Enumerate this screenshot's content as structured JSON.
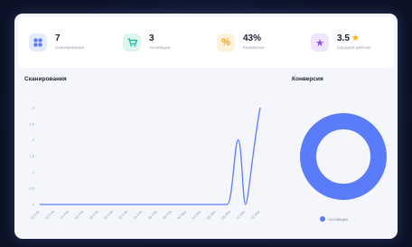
{
  "stats": [
    {
      "value": "7",
      "label": "Сканирования",
      "icon": "grid-icon",
      "icon_color": "#5b7cfa",
      "icon_bg": "#e6ecff"
    },
    {
      "value": "3",
      "label": "Активации",
      "icon": "cart-icon",
      "icon_color": "#16b89a",
      "icon_bg": "#ddf6f0"
    },
    {
      "value": "43%",
      "label": "Конверсия",
      "icon": "percent-icon",
      "icon_color": "#f3a21b",
      "icon_bg": "#fff1da"
    },
    {
      "value": "3.5",
      "label": "Средний рейтинг",
      "icon": "star-icon",
      "icon_color": "#8b4df0",
      "icon_bg": "#efe5ff"
    }
  ],
  "scans_panel": {
    "title": "Сканирования"
  },
  "conversion_panel": {
    "title": "Конверсия"
  },
  "colors": {
    "accent": "#5b7cfa",
    "background": "#0c1226",
    "card": "#f4f6fb"
  },
  "chart_data": [
    {
      "type": "line",
      "title": "Сканирования",
      "x": [
        "10 Feb",
        "12 Feb",
        "14 Feb",
        "16 Feb",
        "18 Feb",
        "20 Feb",
        "22 Feb",
        "24 Feb",
        "26 Feb",
        "28 Feb",
        "02 Mar",
        "04 Mar",
        "06 Mar",
        "08 Mar",
        "10 Mar",
        "12 Mar"
      ],
      "series": [
        {
          "values": [
            0,
            0,
            0,
            0,
            0,
            0,
            0,
            0,
            0,
            0,
            0,
            0,
            0,
            0,
            0,
            0
          ]
        }
      ],
      "peaks": [
        {
          "x": "09 Mar",
          "y": 2
        },
        {
          "x": "10 Mar",
          "y": 0
        },
        {
          "x": "12 Mar",
          "y": 3
        }
      ],
      "yticks": [
        "0",
        "0.5",
        "1",
        "1.5",
        "2",
        "2.5",
        "3"
      ],
      "ylim": [
        0,
        3
      ],
      "grid": false
    },
    {
      "type": "pie",
      "title": "Конверсия",
      "categories": [
        "Активации"
      ],
      "values": [
        100
      ],
      "legend": "bottom"
    }
  ]
}
